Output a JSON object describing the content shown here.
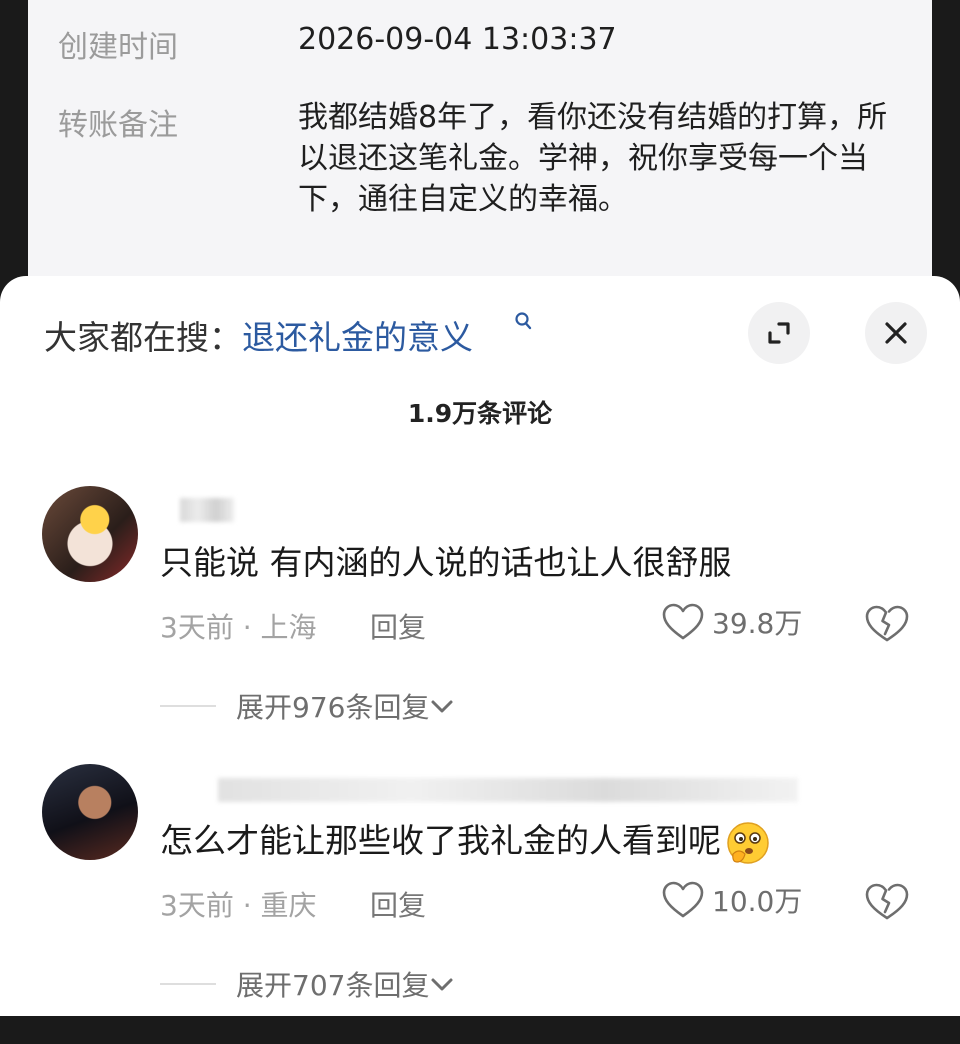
{
  "transfer": {
    "created_label": "创建时间",
    "created_value": "2026-09-04 13:03:37",
    "note_label": "转账备注",
    "note_value": "我都结婚8年了，看你还没有结婚的打算，所以退还这笔礼金。学神，祝你享受每一个当下，通往自定义的幸福。"
  },
  "search": {
    "prefix": "大家都在搜：",
    "link": "退还礼金的意义"
  },
  "comment_count": "1.9万条评论",
  "comments": [
    {
      "text": "只能说 有内涵的人说的话也让人很舒服",
      "meta": "3天前 · 上海",
      "reply": "回复",
      "likes": "39.8万",
      "more": "展开976条回复"
    },
    {
      "text": "怎么才能让那些收了我礼金的人看到呢",
      "meta": "3天前 · 重庆",
      "reply": "回复",
      "likes": "10.0万",
      "more": "展开707条回复"
    }
  ],
  "colors": {
    "link": "#2c5aa0",
    "muted": "#a3a3a3"
  },
  "icons": [
    "search-icon",
    "expand-icon",
    "close-icon",
    "heart-icon",
    "broken-heart-icon",
    "chevron-down-icon",
    "thinking-emoji-icon"
  ]
}
